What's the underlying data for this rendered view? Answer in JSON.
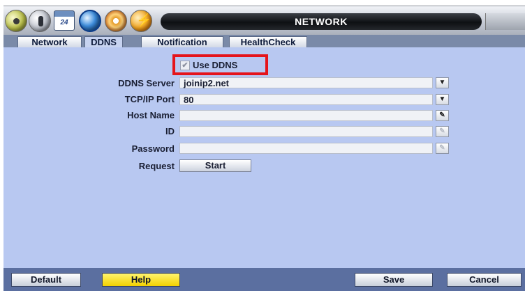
{
  "header": {
    "title": "NETWORK",
    "calendar_label": "24",
    "icons": [
      "setup-icon",
      "camera-icon",
      "calendar-icon",
      "network-icon",
      "disc-icon",
      "power-icon"
    ]
  },
  "tabs": [
    {
      "label": "Network",
      "active": false
    },
    {
      "label": "DDNS",
      "active": true
    },
    {
      "label": "Notification",
      "active": false
    },
    {
      "label": "HealthCheck",
      "active": false
    }
  ],
  "form": {
    "use_ddns": {
      "label": "Use DDNS",
      "checked": true
    },
    "ddns_server": {
      "label": "DDNS Server",
      "value": "joinip2.net"
    },
    "tcp_ip_port": {
      "label": "TCP/IP Port",
      "value": "80"
    },
    "host_name": {
      "label": "Host Name",
      "value": ""
    },
    "id": {
      "label": "ID",
      "value": ""
    },
    "password": {
      "label": "Password",
      "value": ""
    },
    "request": {
      "label": "Request",
      "button": "Start"
    }
  },
  "footer": {
    "default": "Default",
    "help": "Help",
    "save": "Save",
    "cancel": "Cancel"
  },
  "colors": {
    "highlight_box": "#e5141b",
    "panel_bg": "#b8c8f1",
    "help_button": "#f3d000"
  }
}
